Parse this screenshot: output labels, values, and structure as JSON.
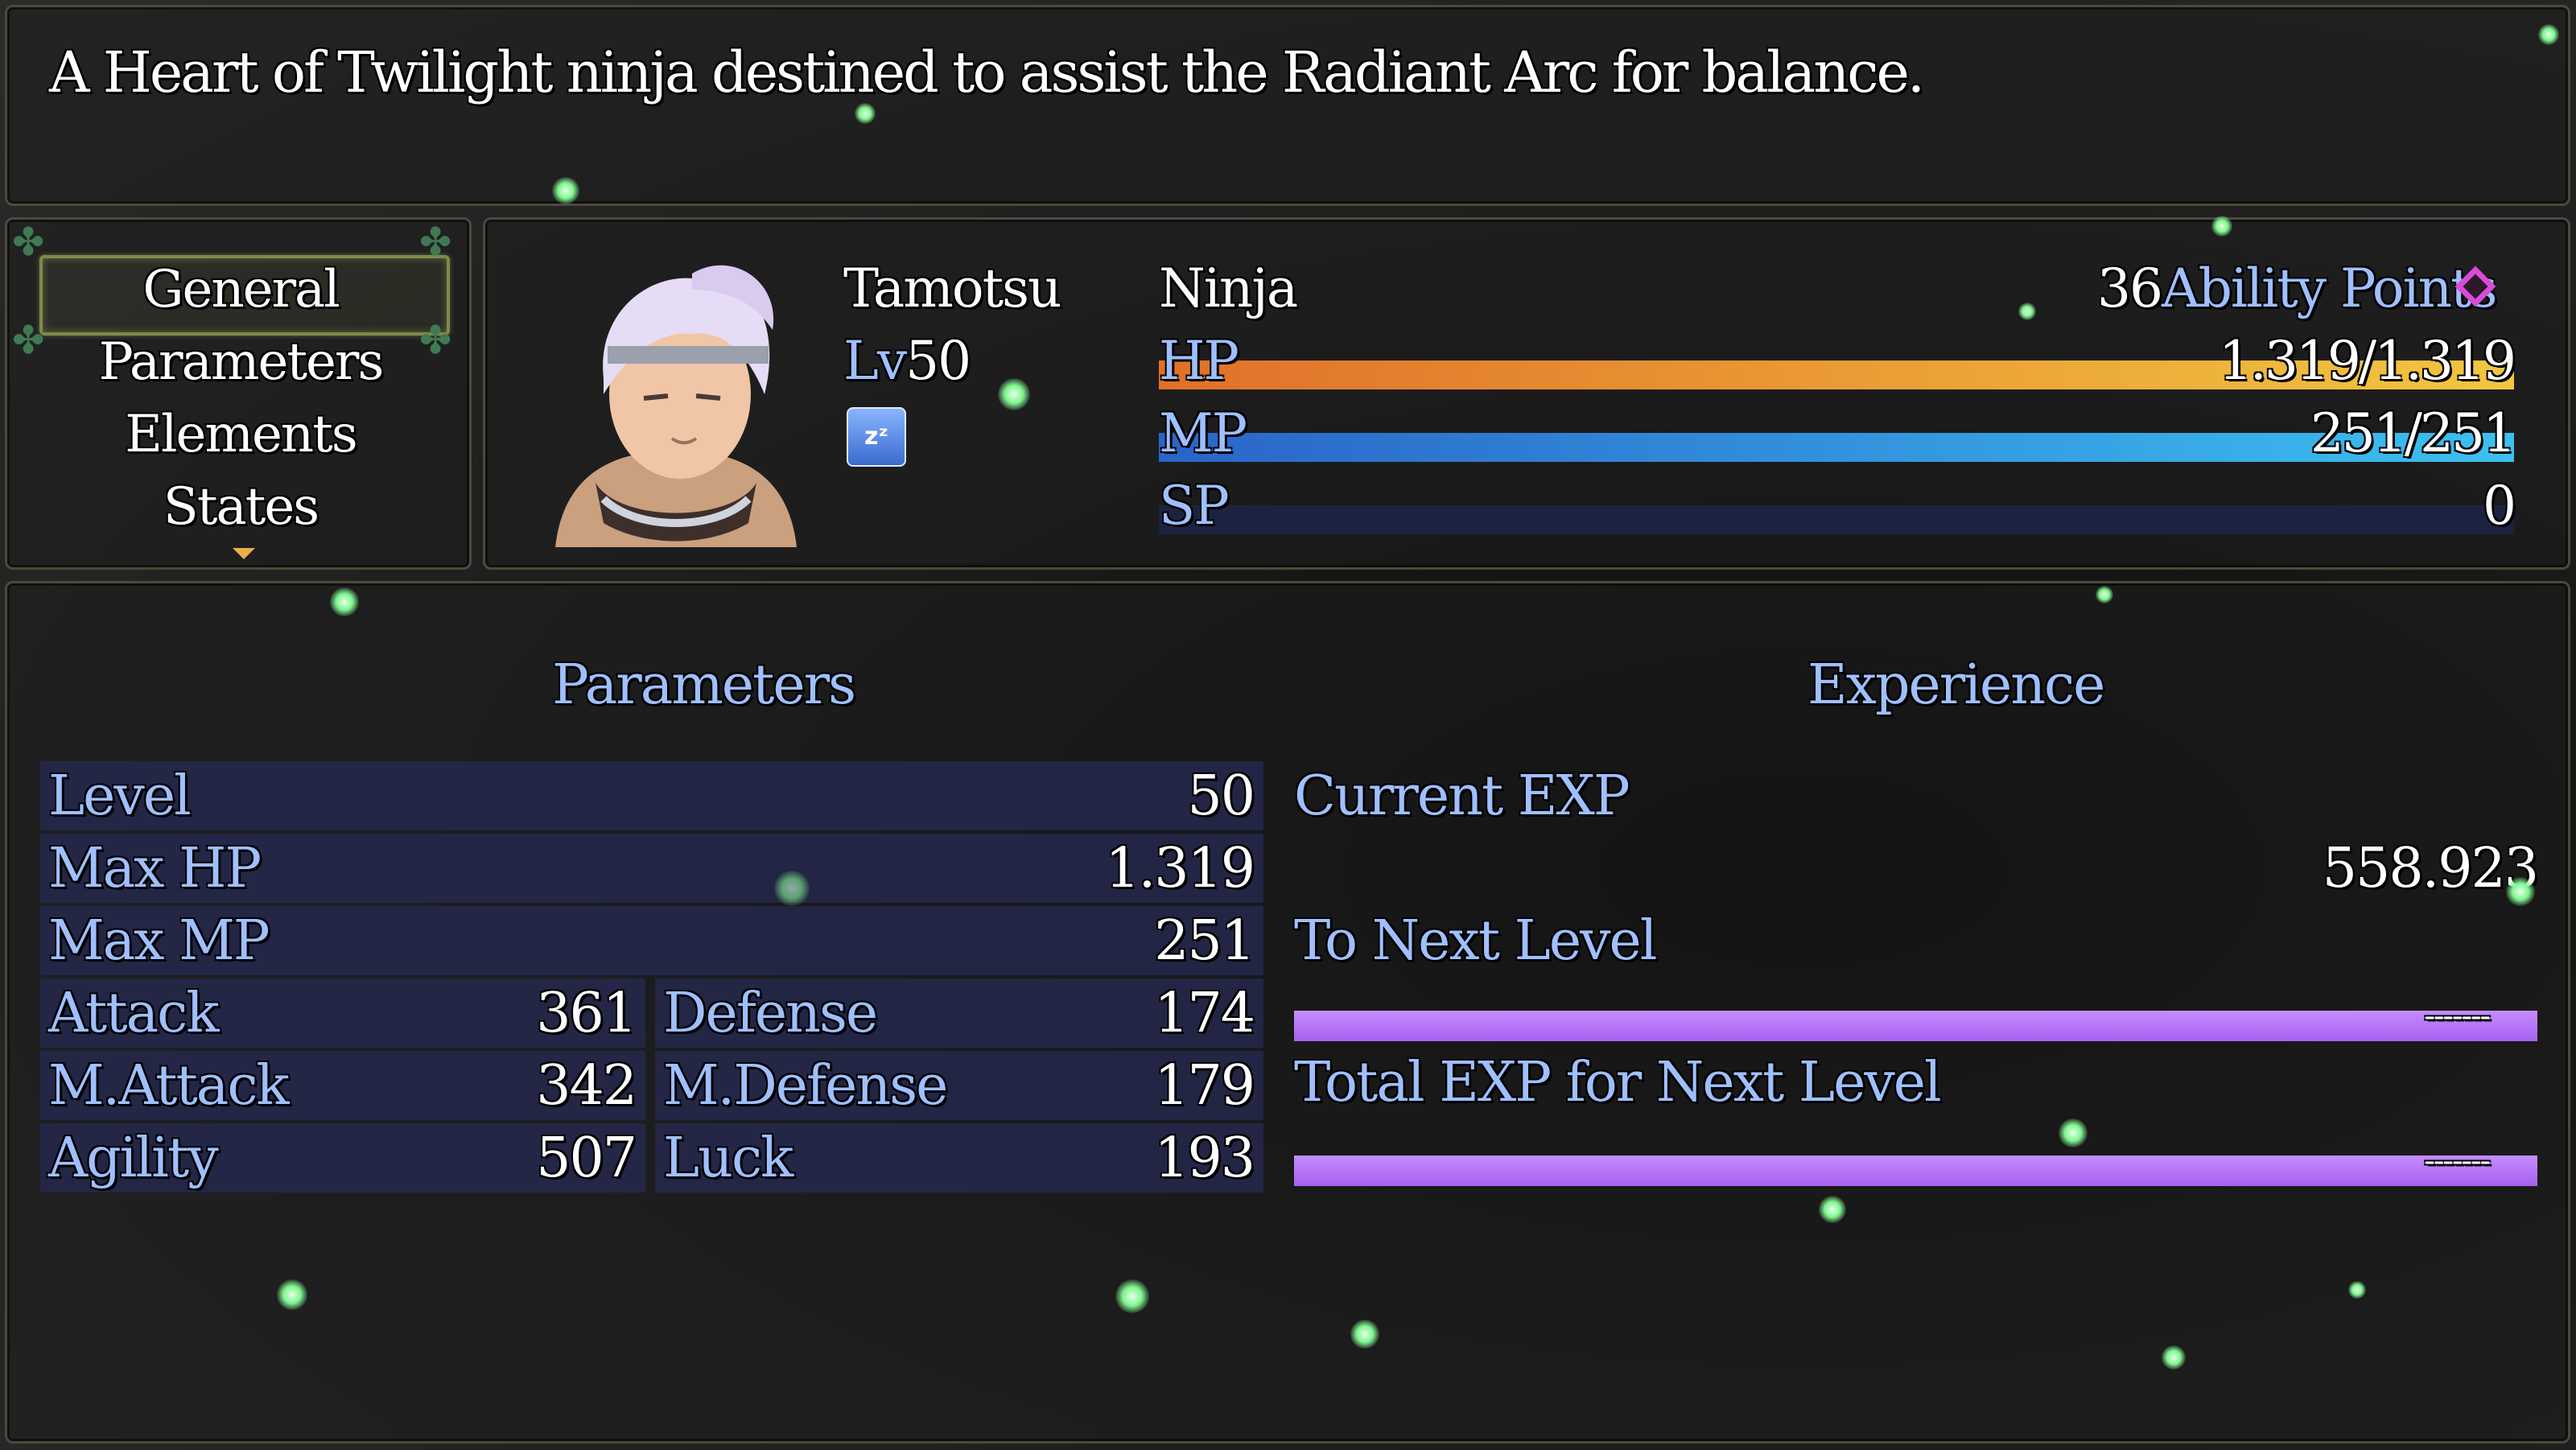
{
  "help": {
    "text": "A Heart of Twilight ninja destined to assist the Radiant Arc for balance."
  },
  "command_menu": {
    "items": [
      "General",
      "Parameters",
      "Elements",
      "States"
    ],
    "selected": "General"
  },
  "actor": {
    "name": "Tamotsu",
    "level_prefix": "Lv",
    "level": "50",
    "class": "Ninja",
    "state_icon": "sleep-icon",
    "ability_points_value": "36",
    "ability_points_label": "Ability Points",
    "hp_label": "HP",
    "hp_text": "1.319/1.319",
    "hp_fraction": 1.0,
    "mp_label": "MP",
    "mp_text": "251/251",
    "mp_fraction": 1.0,
    "sp_label": "SP",
    "sp_text": "0",
    "sp_fraction": 0.0
  },
  "parameters": {
    "header": "Parameters",
    "rows": [
      {
        "label": "Level",
        "value": "50"
      },
      {
        "label": "Max HP",
        "value": "1.319"
      },
      {
        "label": "Max MP",
        "value": "251"
      }
    ],
    "pairs": [
      {
        "left_label": "Attack",
        "left_value": "361",
        "right_label": "Defense",
        "right_value": "174"
      },
      {
        "left_label": "M.Attack",
        "left_value": "342",
        "right_label": "M.Defense",
        "right_value": "179"
      },
      {
        "left_label": "Agility",
        "left_value": "507",
        "right_label": "Luck",
        "right_value": "193"
      }
    ]
  },
  "experience": {
    "header": "Experience",
    "current_label": "Current EXP",
    "current_value": "558.923",
    "next_label": "To Next Level",
    "next_value": "-------",
    "total_label": "Total EXP for Next Level",
    "total_value": "-------"
  },
  "colors": {
    "hp_gauge_start": "#e0702a",
    "hp_gauge_end": "#f2c640",
    "mp_gauge_start": "#2a64c8",
    "mp_gauge_end": "#3cc0f0",
    "system_blue": "#9fbfff",
    "exp_bar": "#a860f0"
  }
}
